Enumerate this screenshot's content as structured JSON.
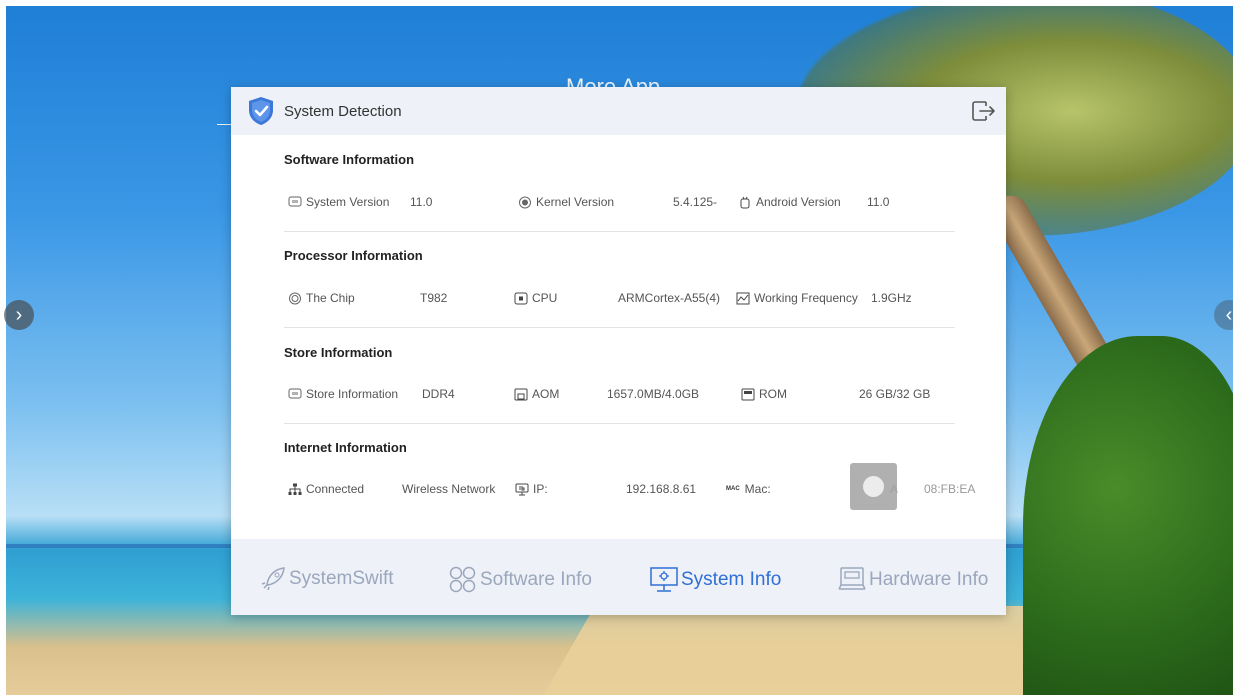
{
  "background": {
    "title": "More App"
  },
  "nav": {
    "left_arrow": "›",
    "right_arrow": "‹"
  },
  "dialog": {
    "title": "System Detection",
    "title_icon": "shield-check-icon",
    "exit_icon": "exit-icon"
  },
  "sections": {
    "software": {
      "title": "Software Information",
      "items": [
        {
          "label": "System Version",
          "value": "11.0",
          "icon": "system-icon"
        },
        {
          "label": "Kernel Version",
          "value": "5.4.125-",
          "icon": "chip-icon"
        },
        {
          "label": "Android Version",
          "value": "11.0",
          "icon": "android-icon"
        }
      ]
    },
    "processor": {
      "title": "Processor Information",
      "items": [
        {
          "label": "The Chip",
          "value": "T982",
          "icon": "chip-icon"
        },
        {
          "label": "CPU",
          "value": "ARMCortex-A55(4)",
          "icon": "cpu-icon"
        },
        {
          "label": "Working Frequency",
          "value": "1.9GHz",
          "icon": "frequency-icon"
        }
      ]
    },
    "store": {
      "title": "Store Information",
      "items": [
        {
          "label": "Store Information",
          "value": "DDR4",
          "icon": "memory-icon"
        },
        {
          "label": "AOM",
          "value": "1657.0MB/4.0GB",
          "icon": "ram-icon"
        },
        {
          "label": "ROM",
          "value": "26 GB/32 GB",
          "icon": "rom-icon"
        }
      ]
    },
    "internet": {
      "title": "Internet Information",
      "items": [
        {
          "label": "Connected",
          "value": "Wireless Network",
          "icon": "network-icon"
        },
        {
          "label": "IP:",
          "value": "192.168.8.61",
          "icon": "ip-icon"
        },
        {
          "label": "Mac:",
          "mac_badge": "MAC",
          "value_prefix": "A",
          "value": "08:FB:EA",
          "icon": "mac-icon"
        }
      ]
    }
  },
  "tabs": [
    {
      "label": "SystemSwift",
      "icon": "rocket-icon",
      "active": false
    },
    {
      "label": "Software Info",
      "icon": "apps-icon",
      "active": false
    },
    {
      "label": "System Info",
      "icon": "system-info-icon",
      "active": true
    },
    {
      "label": "Hardware Info",
      "icon": "hardware-icon",
      "active": false
    }
  ],
  "colors": {
    "accent": "#2f6fd6",
    "inactive_tab": "#9aa7bd",
    "header_bg": "#eef1f7"
  }
}
